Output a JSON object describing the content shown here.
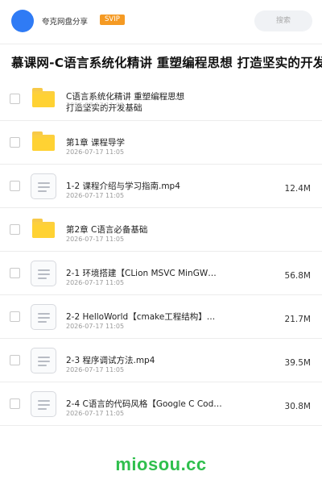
{
  "header": {
    "title": "夸克网盘分享",
    "badge": "SVIP",
    "search_placeholder": "搜索"
  },
  "share_title": "慕课网-C语言系统化精讲 重塑编程思想 打造坚实的开发基础",
  "files": [
    {
      "type": "folder",
      "name_line1": "C语言系统化精讲 重塑编程思想",
      "name_line2": "打造坚实的开发基础",
      "date": "2026-07-17 11:05",
      "size": ""
    },
    {
      "type": "folder",
      "name": "第1章 课程导学",
      "date": "2026-07-17 11:05",
      "size": ""
    },
    {
      "type": "file",
      "name": "1-2 课程介绍与学习指南.mp4",
      "date": "2026-07-17 11:05",
      "size": "12.4M"
    },
    {
      "type": "folder",
      "name": "第2章 C语言必备基础",
      "date": "2026-07-17 11:05",
      "size": ""
    },
    {
      "type": "file",
      "name": "2-1 环境搭建【CLion MSVC MinGW…",
      "date": "2026-07-17 11:05",
      "size": "56.8M"
    },
    {
      "type": "file",
      "name": "2-2 HelloWorld【cmake工程结构】…",
      "date": "2026-07-17 11:05",
      "size": "21.7M"
    },
    {
      "type": "file",
      "name": "2-3 程序调试方法.mp4",
      "date": "2026-07-17 11:05",
      "size": "39.5M"
    },
    {
      "type": "file",
      "name": "2-4 C语言的代码风格【Google C Cod…",
      "date": "2026-07-17 11:05",
      "size": "30.8M"
    }
  ],
  "watermark": "miosou.cc",
  "colors": {
    "accent_blue": "#2f7bf5",
    "svip_orange": "#f59a23",
    "folder_yellow": "#ffd233",
    "watermark_green": "#2fbf4d"
  },
  "icons": {
    "folder": "folder-icon",
    "file": "document-icon",
    "avatar": "avatar"
  }
}
